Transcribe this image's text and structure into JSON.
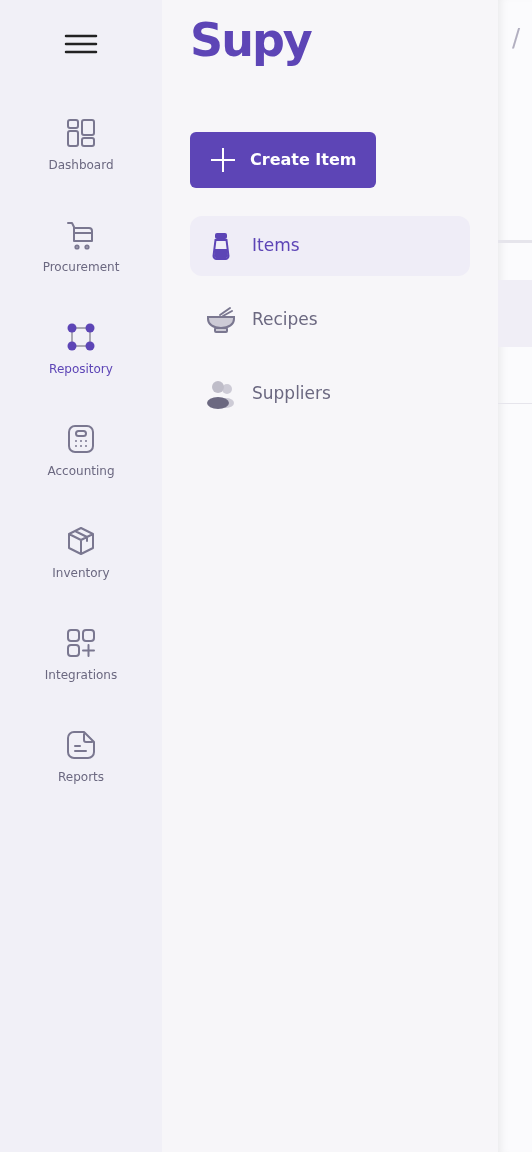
{
  "rail": {
    "items": [
      {
        "label": "Dashboard",
        "kind": "dashboard",
        "selected": false
      },
      {
        "label": "Procurement",
        "kind": "cart",
        "selected": false
      },
      {
        "label": "Repository",
        "kind": "repository",
        "selected": true
      },
      {
        "label": "Accounting",
        "kind": "calculator",
        "selected": false
      },
      {
        "label": "Inventory",
        "kind": "box",
        "selected": false
      },
      {
        "label": "Integrations",
        "kind": "apps",
        "selected": false
      },
      {
        "label": "Reports",
        "kind": "report",
        "selected": false
      }
    ]
  },
  "drawer": {
    "logo": "Supy",
    "create_button": "Create Item",
    "items": [
      {
        "label": "Items",
        "kind": "shaker",
        "selected": true
      },
      {
        "label": "Recipes",
        "kind": "bowl",
        "selected": false
      },
      {
        "label": "Suppliers",
        "kind": "people",
        "selected": false
      }
    ]
  },
  "background": {
    "breadcrumb_separator": "/"
  }
}
